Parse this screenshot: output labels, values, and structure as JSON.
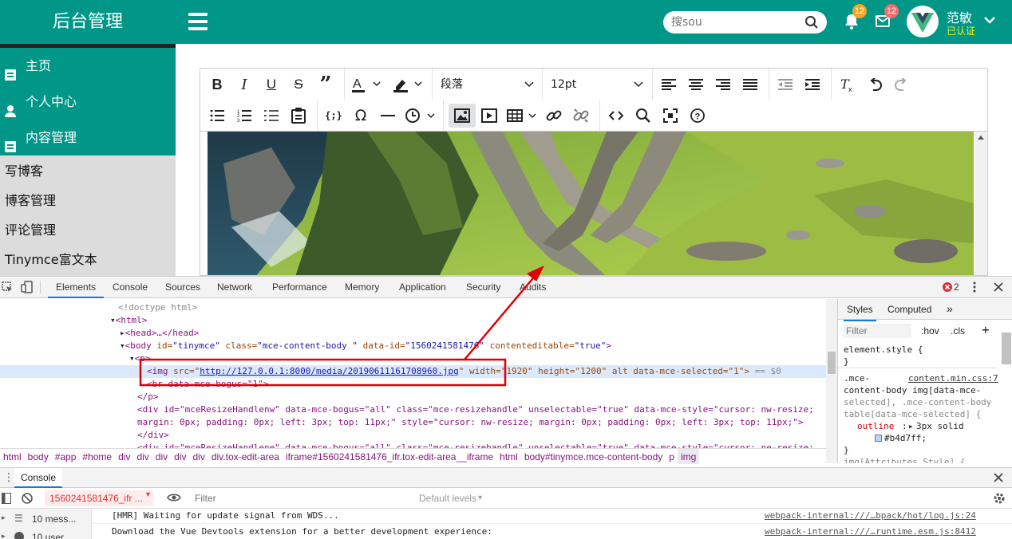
{
  "header": {
    "brand": "后台管理",
    "search_placeholder": "搜sou",
    "notifications": {
      "bell_count": "12",
      "mail_count": "12"
    },
    "user": {
      "name": "范敏",
      "status": "已认证"
    }
  },
  "sidebar": {
    "items": [
      {
        "label": "主页",
        "icon": "document-icon"
      },
      {
        "label": "个人中心",
        "icon": "user-icon"
      },
      {
        "label": "内容管理",
        "icon": "document-icon"
      }
    ],
    "sub_items": [
      "写博客",
      "博客管理",
      "评论管理",
      "Tinymce富文本"
    ]
  },
  "editor": {
    "block_format": "段落",
    "font_size": "12pt"
  },
  "devtools": {
    "tabs": [
      "Elements",
      "Console",
      "Sources",
      "Network",
      "Performance",
      "Memory",
      "Application",
      "Security",
      "Audits"
    ],
    "active_tab": "Elements",
    "error_count": "2",
    "dom": {
      "doctype": "<!doctype html>",
      "html_open": "<html>",
      "head": "<head>…</head>",
      "body_prefix": "<body ",
      "body_id_name": "id=",
      "body_id_val": "\"tinymce\"",
      "body_class_name": " class=",
      "body_class_val": "\"mce-content-body \"",
      "body_dataid_name": " data-id=",
      "body_dataid_val": "\"1560241581476\"",
      "body_ce_name": " contenteditable=",
      "body_ce_val": "\"true\"",
      "body_close": ">",
      "p_open": "<p>",
      "img_open": "<img ",
      "img_src_name": "src=\"",
      "img_src_val": "http://127.0.0.1:8000/media/20190611161708960.jpg",
      "img_rest": "\" width=\"1920\" height=\"1200\" alt data-mce-selected=\"1\">",
      "img_eq": " == $0",
      "br_line": "<br data-mce-bogus=\"1\">",
      "p_close": "</p>",
      "div1_a": "<div id=\"mceResizeHandlenw\" data-mce-bogus=\"all\" class=\"mce-resizehandle\" unselectable=\"true\" data-mce-style=\"cursor: nw-resize;",
      "div1_b": "margin: 0px; padding: 0px; left: 3px; top: 11px;\" style=\"cursor: nw-resize; margin: 0px; padding: 0px; left: 3px; top: 11px;\">",
      "div_close": "</div>",
      "div2_a": "<div id=\"mceResizeHandlene\" data-mce-bogus=\"all\" class=\"mce-resizehandle\" unselectable=\"true\" data-mce-style=\"cursor: ne-resize;"
    },
    "breadcrumb": [
      "html",
      "body",
      "#app",
      "#home",
      "div",
      "div",
      "div",
      "div",
      "div",
      "div.tox-edit-area",
      "iframe#1560241581476_ifr.tox-edit-area__iframe",
      "html",
      "body#tinymce.mce-content-body",
      "p",
      "img"
    ],
    "styles": {
      "tabs": [
        "Styles",
        "Computed"
      ],
      "filter_placeholder": "Filter",
      "hov": ":hov",
      "cls": ".cls",
      "element_style": "element.style {",
      "brace_close": "}",
      "rule_selector_1": ".mce-",
      "rule_source": "content.min.css:7",
      "rule_selector_2": "content-body img[data-mce-",
      "rule_selector_3": "selected], .mce-content-body",
      "rule_selector_4": "table[data-mce-selected] {",
      "prop_name": "outline",
      "prop_value": "3px solid",
      "prop_color": "#b4d7ff;",
      "next_rule": "img[Attributes Style] {"
    },
    "console": {
      "drawer_title": "Console",
      "context": "1560241581476_ifr ...",
      "filter_placeholder": "Filter",
      "levels": "Default levels",
      "messages_count": "10 mess...",
      "user_count": "10 user...",
      "lines": [
        {
          "text": "[HMR] Waiting for update signal from WDS...",
          "source": "webpack-internal:///…bpack/hot/log.js:24"
        },
        {
          "text": "Download the Vue Devtools extension for a better development experience:",
          "source": "webpack-internal:///…runtime.esm.js:8412"
        }
      ]
    }
  },
  "colors": {
    "primary": "#009688",
    "highlight_box": "#e00000",
    "selection": "#dbe9ff"
  }
}
